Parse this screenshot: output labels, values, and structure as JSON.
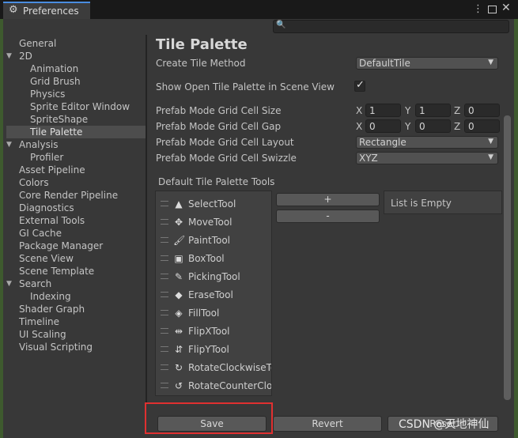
{
  "window": {
    "tab_title": "Preferences",
    "gear_icon": "⚙",
    "kebab_icon": "⋮",
    "close_icon": "✕",
    "search_icon": "🔍",
    "search_value": ""
  },
  "sidebar": {
    "items": [
      {
        "label": "General"
      },
      {
        "label": "2D",
        "fold": "▼"
      },
      {
        "label": "Animation"
      },
      {
        "label": "Grid Brush"
      },
      {
        "label": "Physics"
      },
      {
        "label": "Sprite Editor Window"
      },
      {
        "label": "SpriteShape"
      },
      {
        "label": "Tile Palette",
        "selected": true
      },
      {
        "label": "Analysis",
        "fold": "▼"
      },
      {
        "label": "Profiler"
      },
      {
        "label": "Asset Pipeline"
      },
      {
        "label": "Colors"
      },
      {
        "label": "Core Render Pipeline"
      },
      {
        "label": "Diagnostics"
      },
      {
        "label": "External Tools"
      },
      {
        "label": "GI Cache"
      },
      {
        "label": "Package Manager"
      },
      {
        "label": "Scene View"
      },
      {
        "label": "Scene Template"
      },
      {
        "label": "Search",
        "fold": "▼"
      },
      {
        "label": "Indexing"
      },
      {
        "label": "Shader Graph"
      },
      {
        "label": "Timeline"
      },
      {
        "label": "UI Scaling"
      },
      {
        "label": "Visual Scripting"
      }
    ]
  },
  "panel": {
    "title": "Tile Palette",
    "create_tile_method": {
      "label": "Create Tile Method",
      "value": "DefaultTile"
    },
    "show_open": {
      "label": "Show Open Tile Palette in Scene View",
      "checked": true,
      "check_mark": "✓"
    },
    "cell_size": {
      "label": "Prefab Mode Grid Cell Size",
      "x_label": "X",
      "y_label": "Y",
      "z_label": "Z",
      "x": "1",
      "y": "1",
      "z": "0"
    },
    "cell_gap": {
      "label": "Prefab Mode Grid Cell Gap",
      "x_label": "X",
      "y_label": "Y",
      "z_label": "Z",
      "x": "0",
      "y": "0",
      "z": "0"
    },
    "cell_layout": {
      "label": "Prefab Mode Grid Cell Layout",
      "value": "Rectangle"
    },
    "cell_swizzle": {
      "label": "Prefab Mode Grid Cell Swizzle",
      "value": "XYZ"
    },
    "dropdown_arrow": "▼",
    "tools_header": "Default Tile Palette Tools",
    "tools": [
      {
        "icon": "▲",
        "label": "SelectTool"
      },
      {
        "icon": "✥",
        "label": "MoveTool"
      },
      {
        "icon": "🖌",
        "label": "PaintTool"
      },
      {
        "icon": "▣",
        "label": "BoxTool"
      },
      {
        "icon": "✎",
        "label": "PickingTool"
      },
      {
        "icon": "◆",
        "label": "EraseTool"
      },
      {
        "icon": "◈",
        "label": "FillTool"
      },
      {
        "icon": "⇹",
        "label": "FlipXTool"
      },
      {
        "icon": "⇵",
        "label": "FlipYTool"
      },
      {
        "icon": "↻",
        "label": "RotateClockwiseTool"
      },
      {
        "icon": "↺",
        "label": "RotateCounterClockwiseTool"
      }
    ],
    "add_button": "+",
    "remove_button": "-",
    "list_empty": "List is Empty"
  },
  "footer": {
    "save": "Save",
    "revert": "Revert",
    "reset": "Reset"
  },
  "watermark": "CSDN @天地神仙",
  "colors": {
    "highlight": "#e03030",
    "accent": "#4a8de0"
  }
}
